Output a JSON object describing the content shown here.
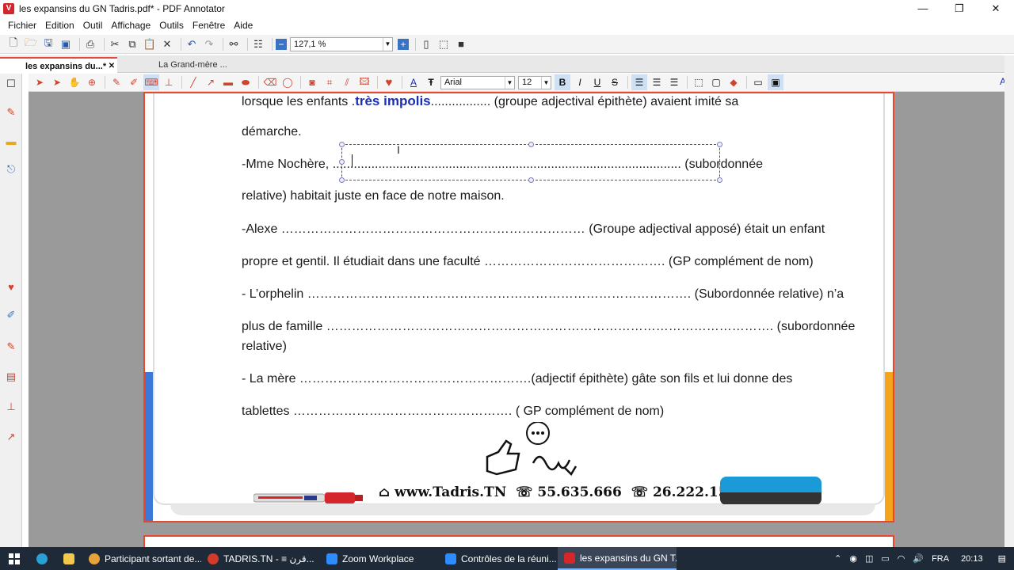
{
  "window": {
    "title": "les expansins du GN Tadris.pdf* - PDF Annotator",
    "controls": {
      "minimize": "—",
      "restore": "❐",
      "close": "✕"
    }
  },
  "menu": [
    "Fichier",
    "Edition",
    "Outil",
    "Affichage",
    "Outils",
    "Fenêtre",
    "Aide"
  ],
  "toolbar": {
    "zoom_value": "127,1 %"
  },
  "tabs": [
    {
      "label": "les expansins du...*"
    },
    {
      "label": "La Grand-mère ..."
    }
  ],
  "font_toolbar": {
    "font_name": "Arial",
    "font_size": "12"
  },
  "document": {
    "line1_prefix": "lorsque les enfants .",
    "line1_handwriting": "très impolis",
    "line1_suffix": "................. (groupe adjectival épithète) avaient imité sa",
    "line2": "démarche.",
    "line3_prefix": "-Mme Nochère, ..",
    "line3_dots": "...............................................................................................",
    "line3_suffix": ".. (subordonnée",
    "line4": "relative) habitait juste en face de notre maison.",
    "line5": "-Alexe ……………………………………………………………… (Groupe adjectival apposé) était un enfant",
    "line6": "propre et gentil. Il étudiait dans une faculté ……………………………………. (GP complément de nom)",
    "line7": "-     L’orphelin ………………………………………………………………………………. (Subordonnée relative) n’a",
    "line8": "plus de famille ……………………………………………………………………………………………. (subordonnée",
    "line9": "relative)",
    "line10": "-     La mère ……………………………………………….(adjectif épithète) gâte son fils et lui donne des",
    "line11": "tablettes ……………………………………………. ( GP complément de nom)",
    "footer_site": "www.Tadris.TN",
    "footer_phone1": "55.635.666",
    "footer_phone2": "26.222.159"
  },
  "taskbar": {
    "items": [
      {
        "label": "Participant sortant de...",
        "color": "#e8a23a"
      },
      {
        "label": "TADRIS.TN - ≡ قرن...",
        "color": "#d23b2c"
      },
      {
        "label": "Zoom Workplace",
        "color": "#2d8cff"
      },
      {
        "label": "Contrôles de la réuni...",
        "color": "#2d8cff"
      },
      {
        "label": "les expansins du GN T...",
        "color": "#d4262b"
      }
    ],
    "lang": "FRA",
    "time": "20:13"
  }
}
